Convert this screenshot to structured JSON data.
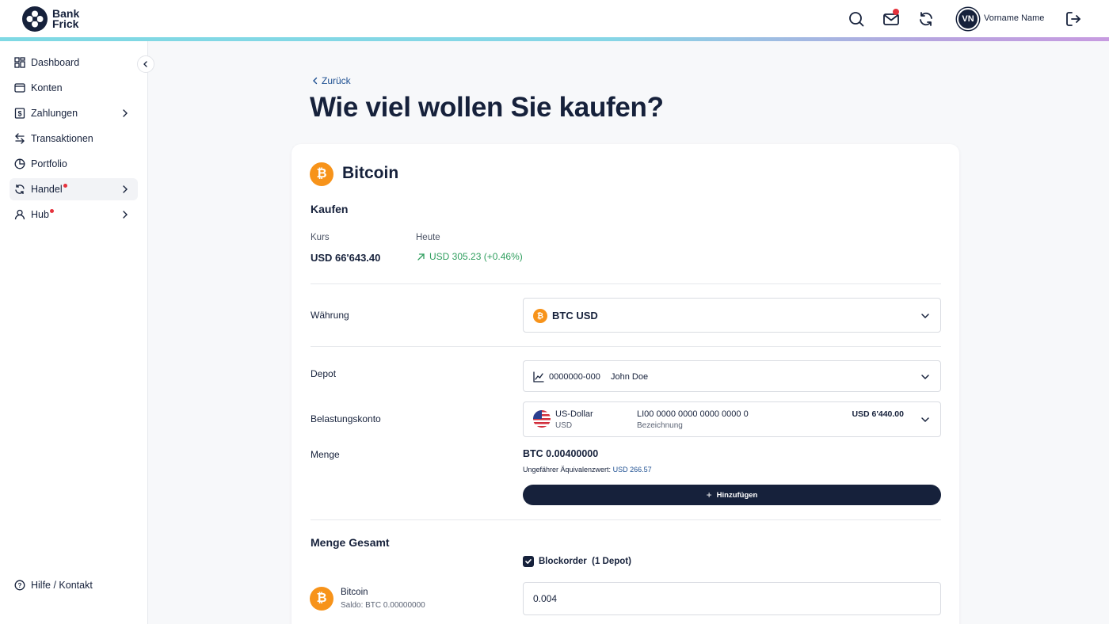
{
  "brand": {
    "line1": "Bank",
    "line2": "Frick"
  },
  "header": {
    "user_initials": "VN",
    "user_name": "Vorname Name"
  },
  "sidebar": {
    "items": [
      {
        "label": "Dashboard"
      },
      {
        "label": "Konten"
      },
      {
        "label": "Zahlungen"
      },
      {
        "label": "Transaktionen"
      },
      {
        "label": "Portfolio"
      },
      {
        "label": "Handel"
      },
      {
        "label": "Hub"
      }
    ],
    "help": "Hilfe / Kontakt"
  },
  "main": {
    "back": "Zurück",
    "title": "Wie viel wollen Sie kaufen?",
    "asset": "Bitcoin",
    "section": "Kaufen",
    "kurs_label": "Kurs",
    "kurs_value": "USD 66'643.40",
    "heute_label": "Heute",
    "heute_value": "USD 305.23 (+0.46%)",
    "waehrung_label": "Währung",
    "waehrung_value": "BTC USD",
    "depot_label": "Depot",
    "depot_number": "0000000-000",
    "depot_name": "John Doe",
    "konto_label": "Belastungskonto",
    "konto_currency_name": "US-Dollar",
    "konto_currency_code": "USD",
    "konto_iban": "LI00 0000 0000 0000 0000 0",
    "konto_desc": "Bezeichnung",
    "konto_balance": "USD 6'440.00",
    "menge_label": "Menge",
    "menge_value": "BTC 0.00400000",
    "equiv_label": "Ungefährer Äquivalenzwert:",
    "equiv_value": "USD 266.57",
    "add_button": "Hinzufügen",
    "total_heading": "Menge Gesamt",
    "blockorder_label": "Blockorder",
    "blockorder_count": "(1 Depot)",
    "coin_name": "Bitcoin",
    "coin_saldo": "Saldo: BTC 0.00000000",
    "qty_value": "0.004"
  },
  "colors": {
    "navy": "#16213b",
    "accent_blue": "#1d4f91",
    "positive": "#2f9e5e",
    "bitcoin": "#f7931a",
    "alert": "#e5323c"
  }
}
